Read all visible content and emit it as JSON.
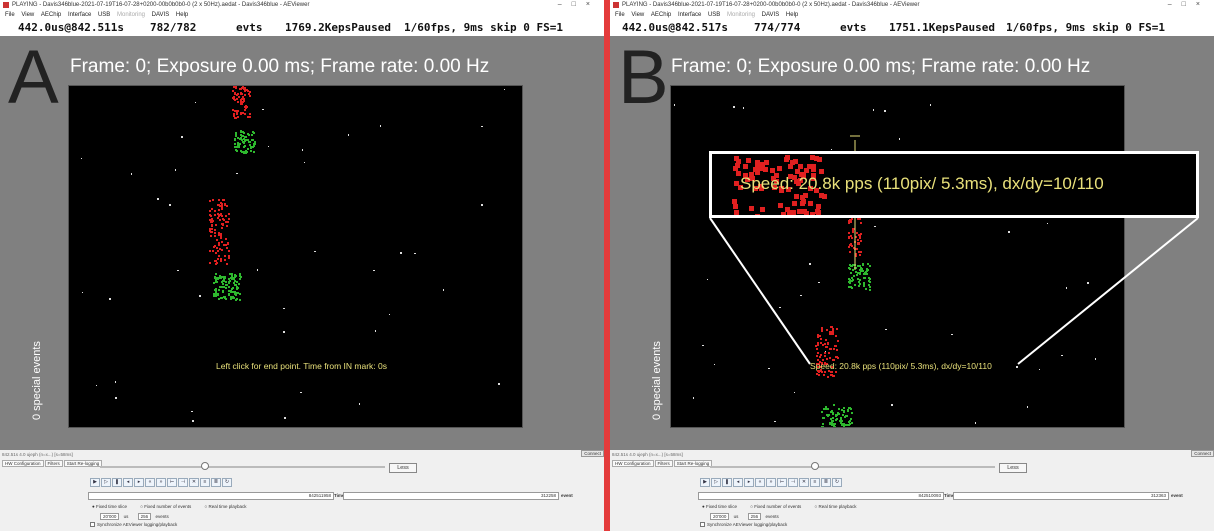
{
  "panelA": {
    "label": "A",
    "titlebar": "PLAYING - Davis346blue-2021-07-19T16-07-28+0200-00b0b0b0-0 (2 x 50Hz).aedat - Davis346blue - AEViewer",
    "menu": [
      "File",
      "View",
      "AEChip",
      "Interface",
      "USB",
      "Monitoring",
      "DAVIS",
      "Help"
    ],
    "status": {
      "time": "442.0us@842.511s",
      "events": "782/782",
      "evts_label": "evts",
      "rate": "1769.2KepsPaused",
      "fps": "1/60fps, 9ms skip 0 FS=1"
    },
    "frame_text": "Frame: 0; Exposure 0.00 ms; Frame rate: 0.00 Hz",
    "special_events": "0 special events",
    "overlay_message": "Left click for end point. Time from IN mark: 0s",
    "lower": {
      "status_line": "842.51s 4.0 ujeph (n=x...) [s=58ms]",
      "connect": "Connect",
      "tabs": [
        "HW Configuration",
        "Filters",
        "Start Re-logging"
      ],
      "less": "Less",
      "time_value": "842511958",
      "time_label": "Time(us)",
      "events_value": "312258",
      "events_label": "event",
      "radios": [
        "Fixed time slice",
        "Fixed number of events",
        "Real time playback"
      ],
      "slice_us": "20'000",
      "us_label": "us",
      "num_events": "256",
      "events_word": "events",
      "sync": "Synchronize AEViewer logging/playback"
    }
  },
  "panelB": {
    "label": "B",
    "titlebar": "PLAYING - Davis346blue-2021-07-19T16-07-28+0200-00b0b0b0-0 (2 x 50Hz).aedat - Davis346blue - AEViewer",
    "menu": [
      "File",
      "View",
      "AEChip",
      "Interface",
      "USB",
      "Monitoring",
      "DAVIS",
      "Help"
    ],
    "status": {
      "time": "442.0us@842.517s",
      "events": "774/774",
      "evts_label": "evts",
      "rate": "1751.1KepsPaused",
      "fps": "1/60fps, 9ms skip 0 FS=1"
    },
    "frame_text": "Frame: 0; Exposure 0.00 ms; Frame rate: 0.00 Hz",
    "special_events": "0 special events",
    "speed_small": "Speed: 20.8k pps (110pix/ 5.3ms), dx/dy=10/110",
    "callout": "Speed: 20.8k pps (110pix/ 5.3ms), dx/dy=10/110",
    "lower": {
      "status_line": "842.51s 4.0 ujeph (n=x...) [s=58ms]",
      "connect": "Connect",
      "tabs": [
        "HW Configuration",
        "Filters",
        "Start Re-logging"
      ],
      "less": "Less",
      "time_value": "842510093",
      "time_label": "Time(us)",
      "events_value": "312363",
      "events_label": "event",
      "radios": [
        "Fixed time slice",
        "Fixed number of events",
        "Real time playback"
      ],
      "slice_us": "20'000",
      "us_label": "us",
      "num_events": "256",
      "events_word": "events",
      "sync": "Synchronize AEViewer logging/playback"
    }
  },
  "colors": {
    "divider": "#e43b3b",
    "on_events": "#2eb82e",
    "off_events": "#e02020",
    "annotation": "#e8e07a"
  }
}
